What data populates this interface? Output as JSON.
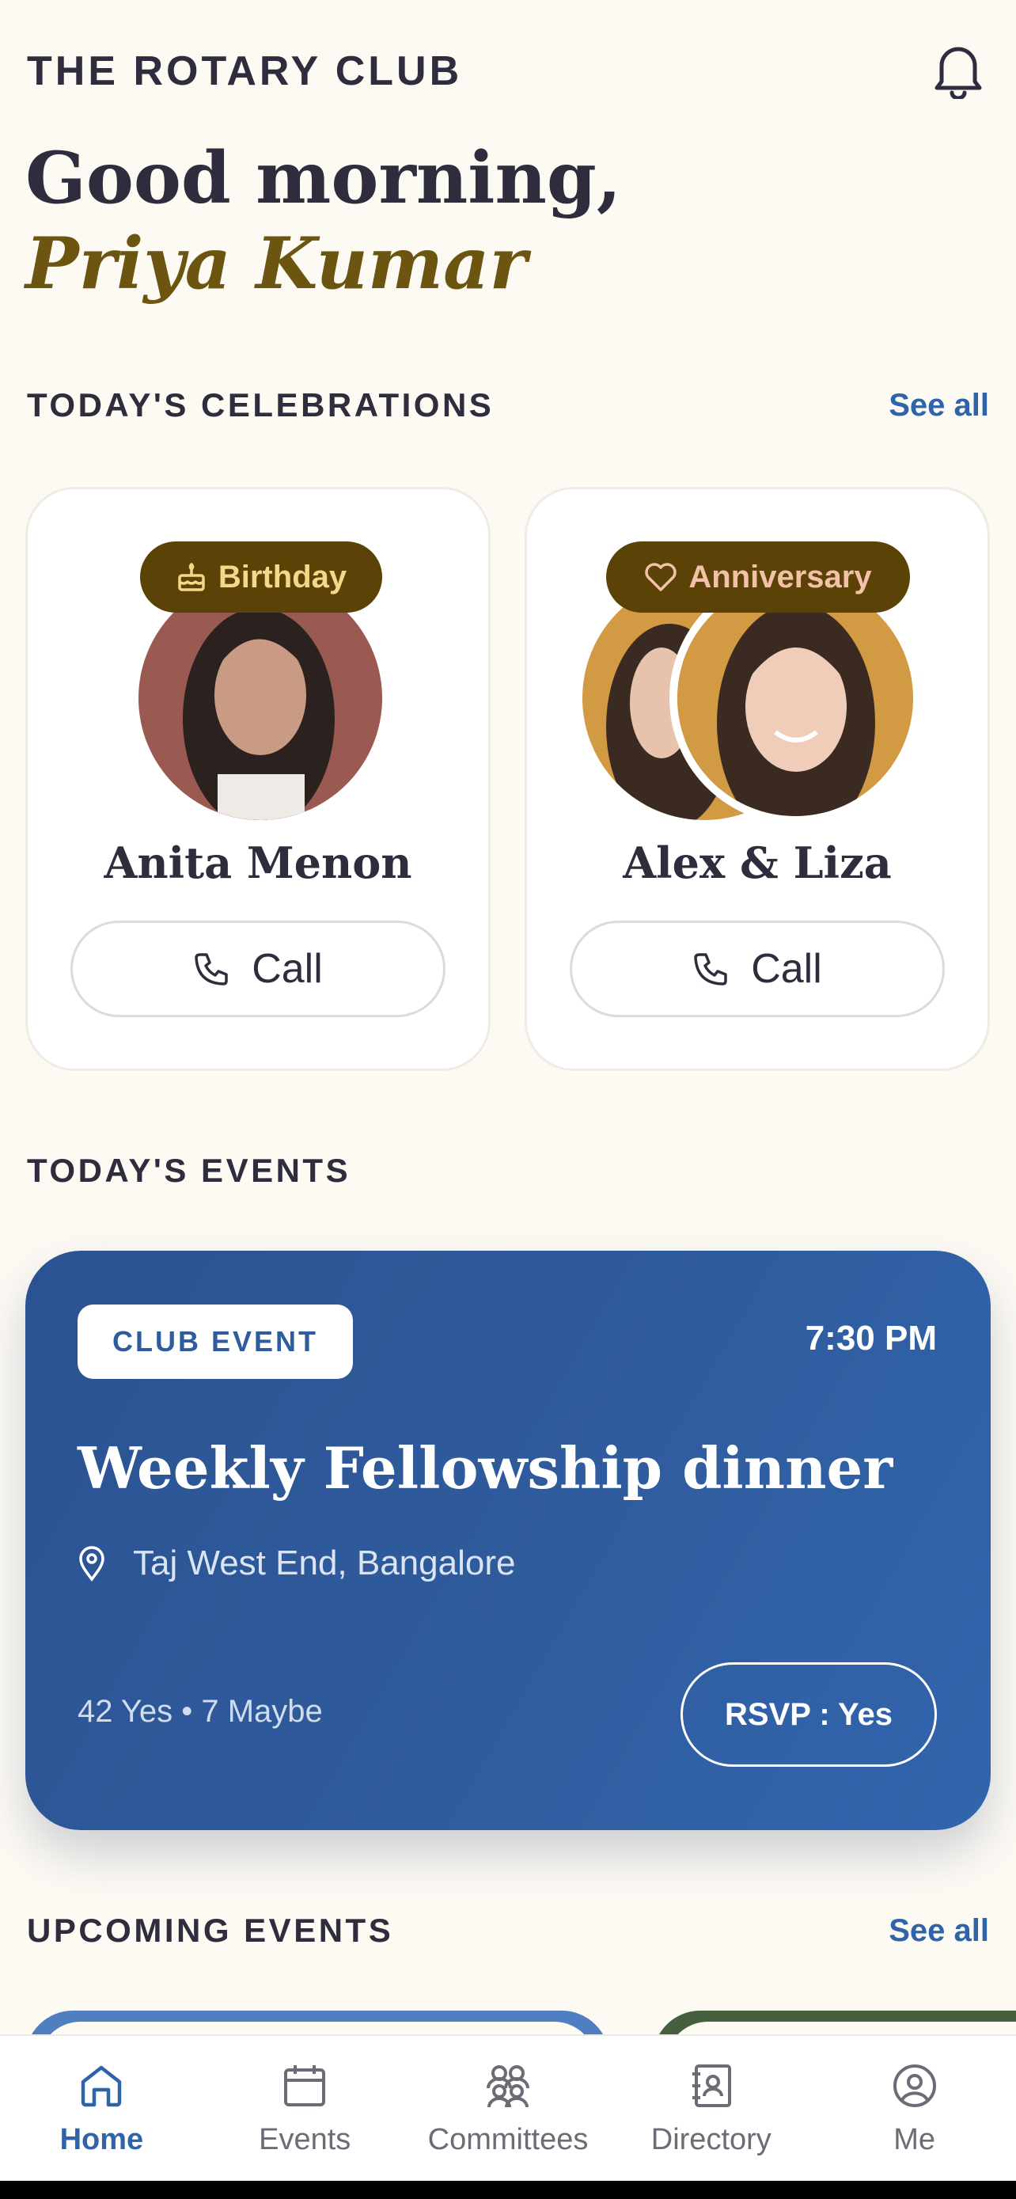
{
  "header": {
    "club_name": "THE ROTARY CLUB",
    "notification_icon": "bell-icon"
  },
  "greeting": {
    "line1": "Good morning,",
    "name": "Priya Kumar"
  },
  "celebrations": {
    "section_title": "TODAY'S CELEBRATIONS",
    "see_all": "See all",
    "cards": [
      {
        "type_label": "Birthday",
        "type_icon": "cake-icon",
        "name": "Anita Menon",
        "call_label": "Call"
      },
      {
        "type_label": "Anniversary",
        "type_icon": "heart-icon",
        "name": "Alex & Liza",
        "call_label": "Call"
      }
    ]
  },
  "todays_events": {
    "section_title": "TODAY'S EVENTS",
    "event": {
      "tag": "CLUB EVENT",
      "time": "7:30 PM",
      "title": "Weekly Fellowship dinner",
      "location": "Taj West End, Bangalore",
      "stats": "42 Yes • 7 Maybe",
      "rsvp_label": "RSVP : Yes"
    }
  },
  "upcoming": {
    "section_title": "UPCOMING EVENTS",
    "see_all": "See all"
  },
  "tab_bar": {
    "tabs": [
      {
        "label": "Home",
        "icon": "home-icon",
        "active": true
      },
      {
        "label": "Events",
        "icon": "calendar-icon",
        "active": false
      },
      {
        "label": "Committees",
        "icon": "people-icon",
        "active": false
      },
      {
        "label": "Directory",
        "icon": "contact-book-icon",
        "active": false
      },
      {
        "label": "Me",
        "icon": "profile-icon",
        "active": false
      }
    ]
  },
  "colors": {
    "background": "#fdfaf4",
    "accent_blue": "#2f64a8",
    "event_card": "#2f5c9e",
    "pill_brown": "#5b4308",
    "name_gold": "#6b5510"
  }
}
